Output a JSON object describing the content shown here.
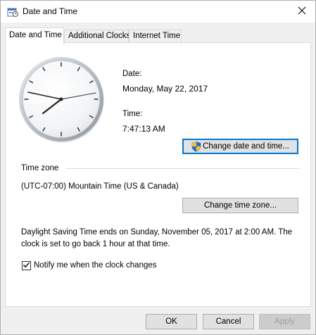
{
  "window": {
    "title": "Date and Time"
  },
  "tabs": [
    {
      "label": "Date and Time",
      "active": true
    },
    {
      "label": "Additional Clocks",
      "active": false
    },
    {
      "label": "Internet Time",
      "active": false
    }
  ],
  "datetime": {
    "date_label": "Date:",
    "date_value": "Monday, May 22, 2017",
    "time_label": "Time:",
    "time_value": "7:47:13 AM",
    "change_button": "Change date and time..."
  },
  "timezone": {
    "section_label": "Time zone",
    "value": "(UTC-07:00) Mountain Time (US & Canada)",
    "change_button": "Change time zone...",
    "dst_line1": "Daylight Saving Time ends on Sunday, November 05, 2017 at 2:00 AM. The",
    "dst_line2": "clock is set to go back 1 hour at that time.",
    "notify_label": "Notify me when the clock changes",
    "notify_checked": true
  },
  "footer": {
    "ok": "OK",
    "cancel": "Cancel",
    "apply": "Apply"
  },
  "icons": {
    "window": "date-time-icon",
    "close": "close-icon",
    "shield": "uac-shield-icon",
    "check": "checkmark-icon"
  }
}
